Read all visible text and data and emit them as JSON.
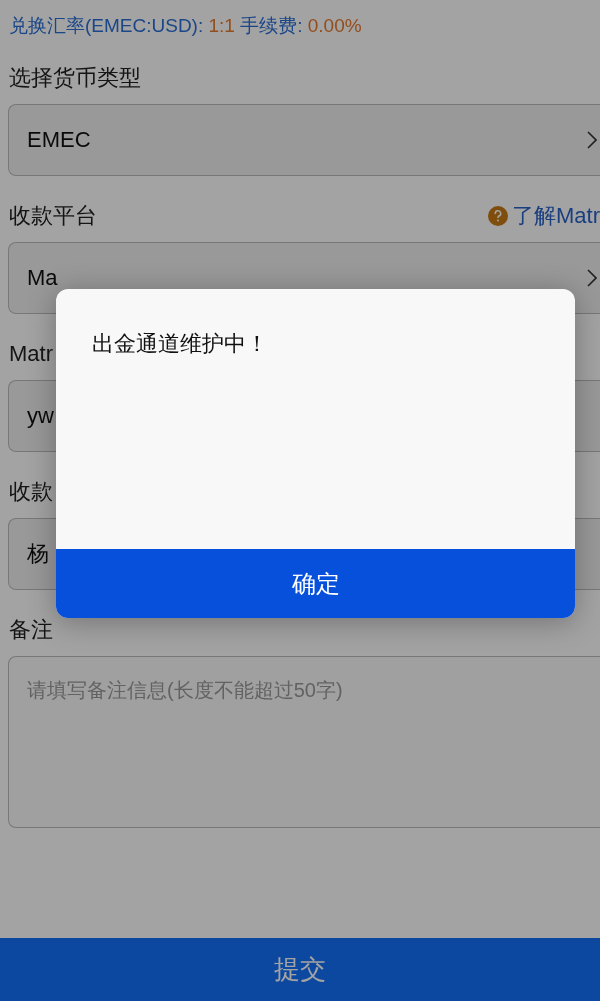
{
  "exchange_info": {
    "rate_label": "兑换汇率(EMEC:USD): ",
    "rate_value": "1:1",
    "fee_label": " 手续费: ",
    "fee_value": "0.00%"
  },
  "fields": [
    {
      "label": "选择货币类型",
      "kind": "select",
      "value": "EMEC"
    },
    {
      "label": "收款平台",
      "kind": "select",
      "value": "Ma",
      "help_link": "了解Matr"
    },
    {
      "label": "Matr",
      "kind": "input",
      "value": "yw"
    },
    {
      "label": "收款",
      "kind": "input",
      "value": "杨"
    },
    {
      "label": "备注",
      "kind": "textarea",
      "placeholder": "请填写备注信息(长度不能超过50字)"
    }
  ],
  "submit_button": "提交",
  "dialog": {
    "message": "出金通道维护中！",
    "confirm_button": "确定"
  }
}
